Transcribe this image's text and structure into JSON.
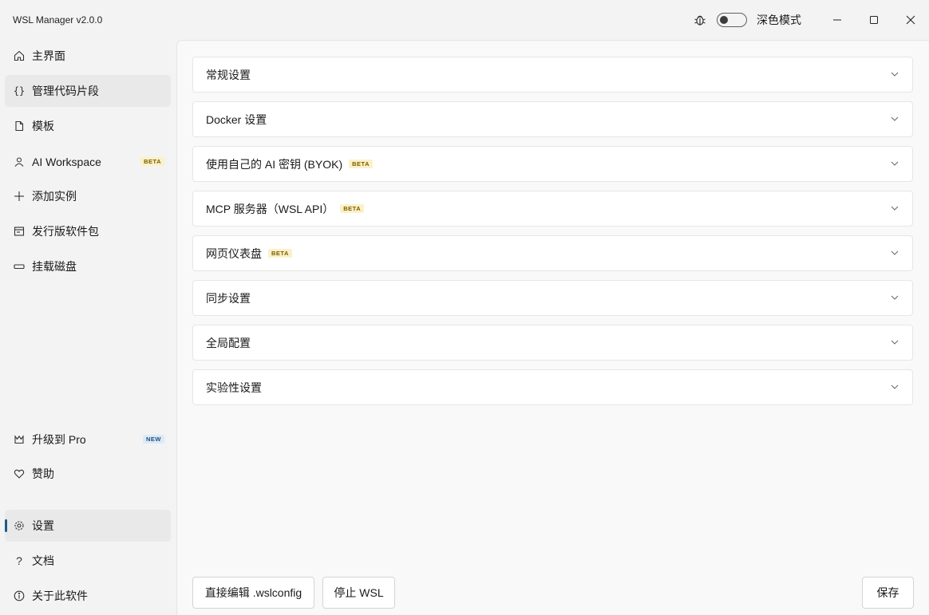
{
  "app": {
    "title": "WSL Manager v2.0.0"
  },
  "titlebar": {
    "dark_mode_label": "深色模式",
    "dark_mode_on": false
  },
  "sidebar": {
    "items": [
      {
        "label": "主界面",
        "icon": "home-icon"
      },
      {
        "label": "管理代码片段",
        "icon": "code-braces-icon"
      },
      {
        "label": "模板",
        "icon": "document-icon"
      },
      {
        "label": "AI Workspace",
        "icon": "person-icon",
        "badge": "BETA"
      },
      {
        "label": "添加实例",
        "icon": "plus-icon"
      },
      {
        "label": "发行版软件包",
        "icon": "package-icon"
      },
      {
        "label": "挂载磁盘",
        "icon": "disk-icon"
      }
    ],
    "bottom_items": [
      {
        "label": "升级到 Pro",
        "icon": "crown-icon",
        "badge": "NEW"
      },
      {
        "label": "赞助",
        "icon": "heart-icon"
      },
      {
        "label": "设置",
        "icon": "gear-icon",
        "active": true
      },
      {
        "label": "文档",
        "icon": "question-icon"
      },
      {
        "label": "关于此软件",
        "icon": "info-icon"
      }
    ]
  },
  "main": {
    "sections": [
      {
        "title": "常规设置"
      },
      {
        "title": "Docker 设置"
      },
      {
        "title": "使用自己的 AI 密钥 (BYOK)",
        "badge": "BETA"
      },
      {
        "title": "MCP 服务器（WSL API）",
        "badge": "BETA"
      },
      {
        "title": "网页仪表盘",
        "badge": "BETA"
      },
      {
        "title": "同步设置"
      },
      {
        "title": "全局配置"
      },
      {
        "title": "实验性设置"
      }
    ],
    "buttons": {
      "edit_wslconfig": "直接编辑 .wslconfig",
      "stop_wsl": "停止 WSL",
      "save": "保存"
    }
  },
  "colors": {
    "accent": "#1d5a8a",
    "beta_badge_bg": "#fbf1c8",
    "new_badge_bg": "#dbeaf7"
  }
}
